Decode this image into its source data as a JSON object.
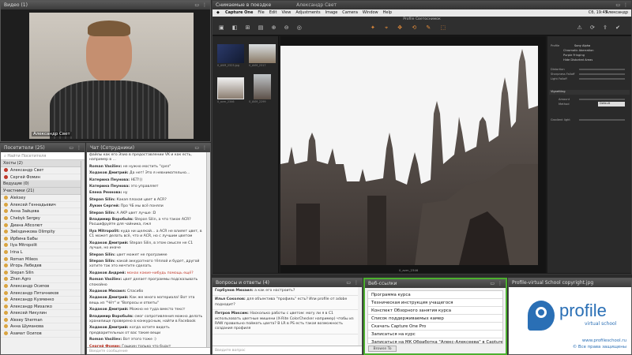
{
  "video_panel": {
    "title": "Видео",
    "count": "(1)",
    "presenter_label": "Александр Свет"
  },
  "attendees": {
    "title": "Посетители",
    "count": "(25)",
    "search_placeholder": "Найти Посетителя",
    "groups": [
      {
        "label": "Хосты (2)",
        "users": [
          "Александр Свет",
          "Сергей Фомин"
        ]
      },
      {
        "label": "Ведущие (0)",
        "users": []
      },
      {
        "label": "Участники (21)",
        "users": [
          "Aleksey",
          "Алексей Геннадьевич",
          "Анна Зайцева",
          "Chebyk Sergey",
          "Диана Абсолют",
          "Звёздинкова Olimpity",
          "Ирбина Бабы",
          "Ilya Mitropolit",
          "Irina L",
          "Roman Mileos",
          "Игорь Лебедев",
          "Stepan Silin",
          "Zhen Agro",
          "Александр Осипов",
          "Александр Пятачников",
          "Александр Кузменко",
          "Александр Михалко",
          "Алексей Никулин",
          "Alexey Sherman",
          "Анна Шуманова",
          "Азамат Осипов"
        ]
      }
    ]
  },
  "chat": {
    "title": "Чат",
    "subtitle": "(Сотрудники)",
    "input_placeholder": "Введите сообщение",
    "messages": [
      {
        "name": "",
        "text": "файлы как его Эзио в предоставлении VK и как есть, например в ...",
        "red_name": false,
        "red_text": false
      },
      {
        "name": "Roman Vasiliev:",
        "text": "не нужно мостить \"срез\"",
        "red_name": false,
        "red_text": false
      },
      {
        "name": "Ходаков Дмитрий:",
        "text": "Да нет! Это я невнимательно...",
        "red_name": false,
        "red_text": false
      },
      {
        "name": "Катерина Пеунова:",
        "text": "НЕТ!))",
        "red_name": false,
        "red_text": false
      },
      {
        "name": "Катерина Пеунова:",
        "text": "это управляет",
        "red_name": false,
        "red_text": false
      },
      {
        "name": "Елена Реннова:",
        "text": "ну",
        "red_name": false,
        "red_text": false
      },
      {
        "name": "Stepan Silin:",
        "text": "Какая плохая цвет в ACR?",
        "red_name": false,
        "red_text": false
      },
      {
        "name": "Лукин Сергей:",
        "text": "Про ЧБ мы всё поняли",
        "red_name": false,
        "red_text": false
      },
      {
        "name": "Stepan Silin:",
        "text": "А AKP цвет лучше :D",
        "red_name": false,
        "red_text": false
      },
      {
        "name": "Владимир Воробьёв:",
        "text": "Stepan Silin, а что такое ACR? Расшифруйте для чайника, пжл",
        "red_name": false,
        "red_text": false
      },
      {
        "name": "Ilya Mitropolit:",
        "text": "куда ни щелкай... а ACR не влияет цвет, в C1 может делать всё, что и ACR, но с лучшим цветом",
        "red_name": false,
        "red_text": false
      },
      {
        "name": "Ходаков Дмитрий:",
        "text": "Stepan Silin, в этом смысле не C1 лучше, но иначе",
        "red_name": false,
        "red_text": false
      },
      {
        "name": "Stepan Silin:",
        "text": "цвет может не программе",
        "red_name": false,
        "red_text": false
      },
      {
        "name": "Stepan Silin:",
        "text": "какой аккуратного тёплой и будет, другой хотите так это мечтите сделать",
        "red_name": false,
        "red_text": false
      },
      {
        "name": "Ходаков Андрей:",
        "text": "монах какие-нибудь помощь ещё?",
        "red_name": false,
        "red_text": true
      },
      {
        "name": "Roman Vasiliev:",
        "text": "цвет делает программы подсказывать спокойно",
        "red_name": false,
        "red_text": false
      },
      {
        "name": "Ходаков Михаил:",
        "text": "Спасибо",
        "red_name": false,
        "red_text": false
      },
      {
        "name": "Ходаков Дмитрий:",
        "text": "Как же много материала! Вот эта вещь из \"Чёт\" и \"Вопросы и ответы\"",
        "red_name": false,
        "red_text": false
      },
      {
        "name": "Ходаков Дмитрий:",
        "text": "Можно не туда вместо текст",
        "red_name": false,
        "red_text": false
      },
      {
        "name": "Владимир Воробьёв:",
        "text": "смог сопротивления можно делать хранилище проверено в конкурсным, найти в Facebook",
        "red_name": false,
        "red_text": false
      },
      {
        "name": "Ходаков Дмитрий:",
        "text": "когда хотите видеть предварительных от вас такие вещи",
        "red_name": false,
        "red_text": false
      },
      {
        "name": "Roman Vasiliev:",
        "text": "Вот этого тоже :)",
        "red_name": false,
        "red_text": false
      },
      {
        "name": "Сергей Фомин:",
        "text": "Гошкин только что будут",
        "red_name": true,
        "red_text": false
      }
    ]
  },
  "capture_one": {
    "window_title": "Снимаемые в поездке",
    "window_subtitle": "Александр Свет",
    "menu": [
      "Capture One",
      "File",
      "Edit",
      "View",
      "Adjustments",
      "Image",
      "Camera",
      "Window",
      "Help"
    ],
    "clock": "Сб, 19:45",
    "user": "Александр",
    "doc_title": "Profile Светоснимок",
    "image_caption": "0_avm_2346",
    "thumbs": [
      "0_AVM_2323.jpg",
      "0_AVM_2317",
      "0_avm_2346",
      "0_AVM_2299"
    ],
    "panel_items": [
      "Chromatic Aberration",
      "Purple Fringing",
      "Hide Distorted Areas"
    ],
    "panel_labels": [
      "Profile",
      "Distortion",
      "Sharpness Falloff",
      "Light Falloff",
      "Vignetting",
      "Amount",
      "Method",
      "Gradient light"
    ],
    "panel_profile": "Sony Alpha",
    "panel_method": "Default"
  },
  "qa": {
    "title": "Вопросы и ответы",
    "count": "(4)",
    "entries": [
      {
        "name": "Горбунов Михаил:",
        "text": "а как его настроить?"
      },
      {
        "name": "Илья Соколов:",
        "text": "для объектива \"профиль\" есть? Или profile от adobe подходит?"
      },
      {
        "name": "Петров Максим:",
        "text": "Насколько работы с цветом: могу ли я в C1 использовать цветные мишени (X-Rite ColorChecker например) чтобы из RAW правильно поймать цвета? В LR в PS есть такая возможность создания профиля"
      }
    ],
    "input_placeholder": "Введите вопрос"
  },
  "weblinks": {
    "title": "Веб-ссылки",
    "items": [
      "Программа курса",
      "Техническая инструкция учащегося",
      "Конспект Обзорного занятия курса",
      "Список поддерживаемых камер",
      "Скачать Capture One Pro",
      "Записаться на курс",
      "Записаться на МК Обработка \"Алекс-Алексеева\" в Capture One"
    ],
    "button": "Browse To"
  },
  "logo_panel": {
    "title": "Profile-virtual School copyright.jpg",
    "brand": "profile",
    "brand_sub": "virtual school",
    "url": "www.profileschool.ru",
    "copyright": "© Все права защищены"
  },
  "colors": {
    "accent_green": "#4caf2f",
    "brand_blue": "#2a6fb5",
    "panel_title": "#4a4a4a",
    "red_text": "#c0392b"
  }
}
